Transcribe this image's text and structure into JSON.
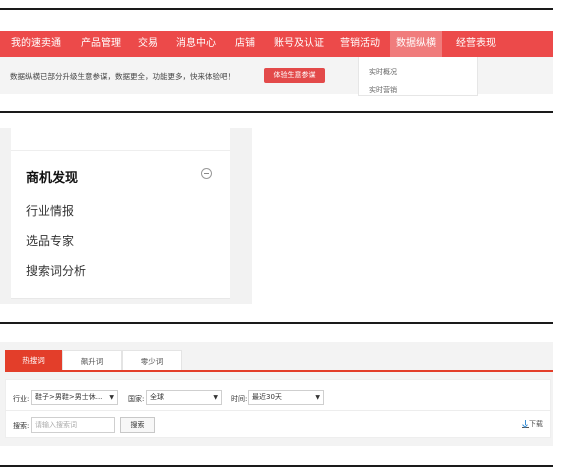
{
  "panel1": {
    "nav": {
      "items": [
        {
          "label": "我的速卖通"
        },
        {
          "label": "产品管理"
        },
        {
          "label": "交易"
        },
        {
          "label": "消息中心"
        },
        {
          "label": "店铺"
        },
        {
          "label": "账号及认证"
        },
        {
          "label": "营销活动"
        },
        {
          "label": "数据纵横"
        },
        {
          "label": "经营表现"
        }
      ],
      "active": "数据纵横"
    },
    "notice": {
      "text": "数据纵横已部分升级生意参谋，数据更全，功能更多，快来体验吧！",
      "button_label": "体验生意参谋"
    },
    "dropdown": {
      "items": [
        {
          "label": "实时概况"
        },
        {
          "label": "实时营销"
        }
      ]
    }
  },
  "panel2": {
    "title": "商机发现",
    "items": [
      {
        "label": "行业情报"
      },
      {
        "label": "选品专家"
      },
      {
        "label": "搜索词分析"
      }
    ]
  },
  "panel3": {
    "tabs": [
      {
        "label": "热搜词"
      },
      {
        "label": "飙升词"
      },
      {
        "label": "零少词"
      }
    ],
    "active_tab": "热搜词",
    "filters": {
      "industry_label": "行业:",
      "industry_value": "鞋子>男鞋>男士休...",
      "country_label": "国家:",
      "country_value": "全球",
      "time_label": "时间:",
      "time_value": "最近30天"
    },
    "search": {
      "label": "搜索:",
      "placeholder": "请输入搜索词",
      "button_label": "搜索"
    },
    "download_label": "下载"
  },
  "colors": {
    "nav_red": "#ec4a4a",
    "nav_active": "#f07c7c",
    "tab_red": "#e33e2a",
    "download_blue": "#3a8fd6"
  }
}
